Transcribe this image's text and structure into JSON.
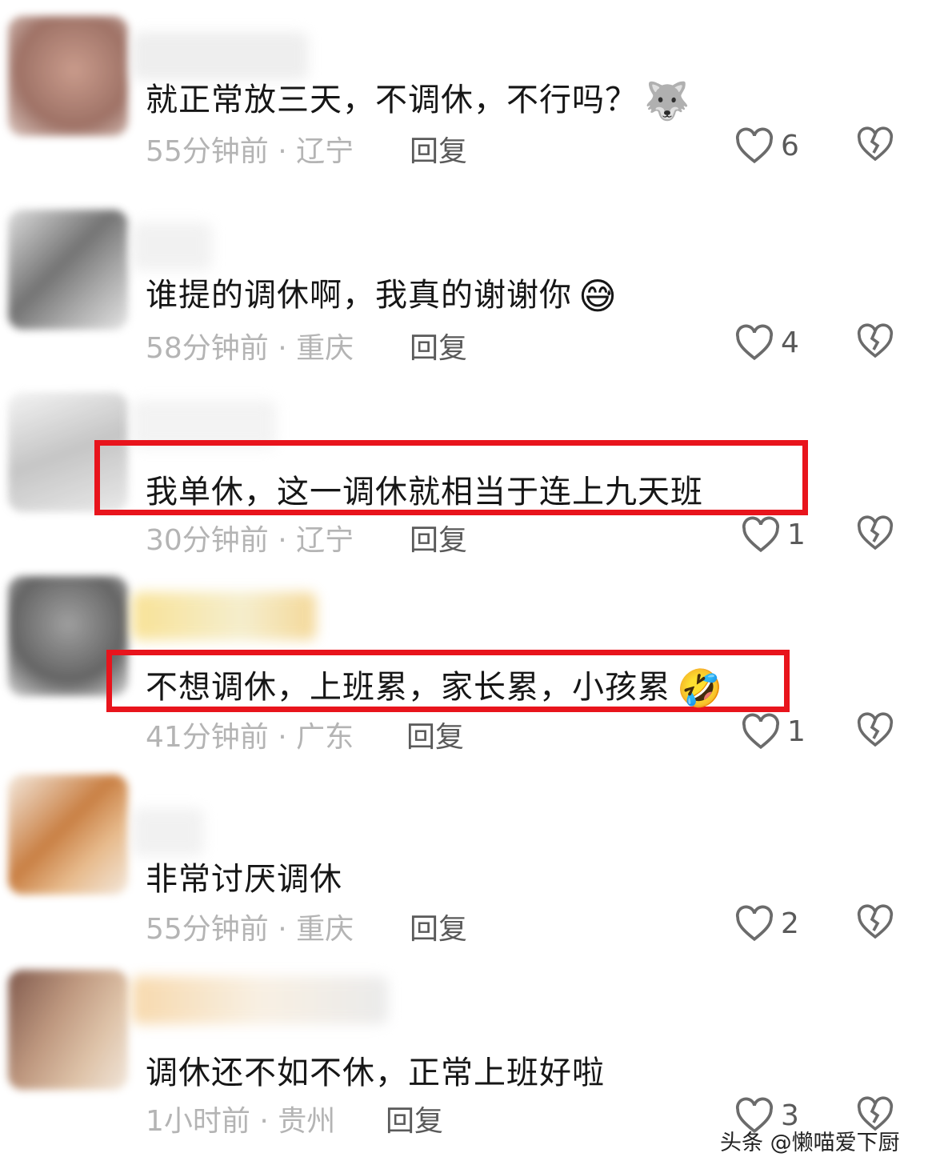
{
  "comments": [
    {
      "text": "就正常放三天，不调休，不行吗？",
      "emoji": "🐺",
      "time": "55分钟前",
      "sep": "·",
      "location": "辽宁",
      "reply": "回复",
      "likes": "6"
    },
    {
      "text": "谁提的调休啊，我真的谢谢你",
      "emoji": "😅",
      "time": "58分钟前",
      "sep": "·",
      "location": "重庆",
      "reply": "回复",
      "likes": "4"
    },
    {
      "text": "我单休，这一调休就相当于连上九天班",
      "emoji": "",
      "time": "30分钟前",
      "sep": "·",
      "location": "辽宁",
      "reply": "回复",
      "likes": "1"
    },
    {
      "text": "不想调休，上班累，家长累，小孩累",
      "emoji": "🤣",
      "time": "41分钟前",
      "sep": "·",
      "location": "广东",
      "reply": "回复",
      "likes": "1"
    },
    {
      "text": "非常讨厌调休",
      "emoji": "",
      "time": "55分钟前",
      "sep": "·",
      "location": "重庆",
      "reply": "回复",
      "likes": "2"
    },
    {
      "text": "调休还不如不休，正常上班好啦",
      "emoji": "",
      "time": "1小时前",
      "sep": "·",
      "location": "贵州",
      "reply": "回复",
      "likes": "3"
    }
  ],
  "colors": {
    "highlight": "#e8141c",
    "heart": "#6b6b6b"
  },
  "watermark": "头条 @懒喵爱下厨"
}
